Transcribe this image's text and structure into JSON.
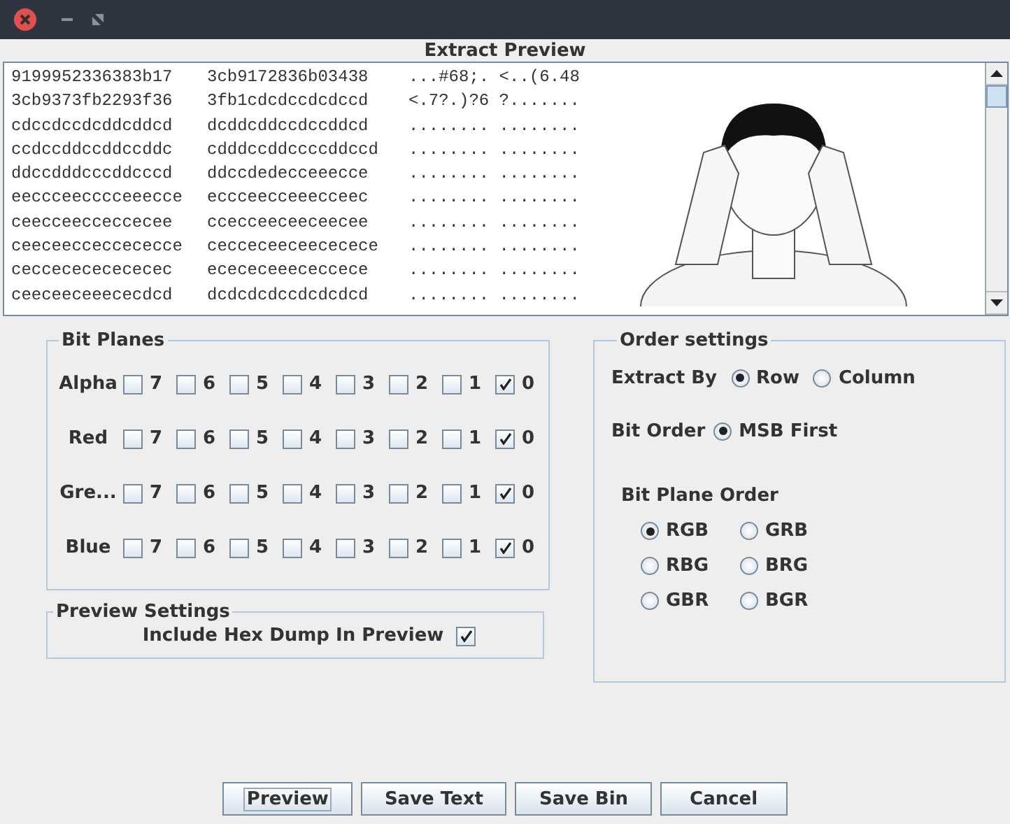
{
  "preview": {
    "title": "Extract Preview",
    "hex_rows": [
      {
        "hex1": "9199952336383b17",
        "hex2": "3cb9172836b03438",
        "ascii": "...#68;. <..(6.48"
      },
      {
        "hex1": "3cb9373fb2293f36",
        "hex2": "3fb1cdcdccdcdccd",
        "ascii": "<.7?.)?6 ?......."
      },
      {
        "hex1": "cdccdccdcddcddcd",
        "hex2": "dcddcddccdccddcd",
        "ascii": "........ ........"
      },
      {
        "hex1": "ccdccddccddccddc",
        "hex2": "cdddccddccccddccd",
        "ascii": "........ ........"
      },
      {
        "hex1": "ddccdddcccddcccd",
        "hex2": "ddccdedecceeecce",
        "ascii": "........ ........"
      },
      {
        "hex1": "eeccceecccceeecce",
        "hex2": "eccceecceeecceec",
        "ascii": "........ ........"
      },
      {
        "hex1": "ceecceecceccecee",
        "hex2": "ccecceeceeceecee",
        "ascii": "........ ........"
      },
      {
        "hex1": "ceeceecceccececce",
        "hex2": "cecceceeceececece",
        "ascii": "........ ........"
      },
      {
        "hex1": "ceccecececececec",
        "hex2": "ecececeeececcece",
        "ascii": "........ ........"
      },
      {
        "hex1": "ceeceeceeececdcd",
        "hex2": "dcdcdcdccdcdcdcd",
        "ascii": "........ ........"
      }
    ]
  },
  "bit_planes": {
    "title": "Bit Planes",
    "channels": [
      {
        "name": "Alpha",
        "bits": [
          {
            "label": "7",
            "checked": false
          },
          {
            "label": "6",
            "checked": false
          },
          {
            "label": "5",
            "checked": false
          },
          {
            "label": "4",
            "checked": false
          },
          {
            "label": "3",
            "checked": false
          },
          {
            "label": "2",
            "checked": false
          },
          {
            "label": "1",
            "checked": false
          },
          {
            "label": "0",
            "checked": true
          }
        ]
      },
      {
        "name": "Red",
        "bits": [
          {
            "label": "7",
            "checked": false
          },
          {
            "label": "6",
            "checked": false
          },
          {
            "label": "5",
            "checked": false
          },
          {
            "label": "4",
            "checked": false
          },
          {
            "label": "3",
            "checked": false
          },
          {
            "label": "2",
            "checked": false
          },
          {
            "label": "1",
            "checked": false
          },
          {
            "label": "0",
            "checked": true
          }
        ]
      },
      {
        "name": "Gre...",
        "bits": [
          {
            "label": "7",
            "checked": false
          },
          {
            "label": "6",
            "checked": false
          },
          {
            "label": "5",
            "checked": false
          },
          {
            "label": "4",
            "checked": false
          },
          {
            "label": "3",
            "checked": false
          },
          {
            "label": "2",
            "checked": false
          },
          {
            "label": "1",
            "checked": false
          },
          {
            "label": "0",
            "checked": true
          }
        ]
      },
      {
        "name": "Blue",
        "bits": [
          {
            "label": "7",
            "checked": false
          },
          {
            "label": "6",
            "checked": false
          },
          {
            "label": "5",
            "checked": false
          },
          {
            "label": "4",
            "checked": false
          },
          {
            "label": "3",
            "checked": false
          },
          {
            "label": "2",
            "checked": false
          },
          {
            "label": "1",
            "checked": false
          },
          {
            "label": "0",
            "checked": true
          }
        ]
      }
    ]
  },
  "preview_settings": {
    "title": "Preview Settings",
    "include_hex_dump": {
      "label": "Include Hex Dump In Preview",
      "checked": true
    }
  },
  "order_settings": {
    "title": "Order settings",
    "extract_by": {
      "label": "Extract By",
      "options": [
        {
          "label": "Row",
          "selected": true
        },
        {
          "label": "Column",
          "selected": false
        }
      ]
    },
    "bit_order": {
      "label": "Bit Order",
      "options": [
        {
          "label": "MSB First",
          "selected": true
        }
      ]
    },
    "bit_plane_order": {
      "label": "Bit Plane Order",
      "options": [
        {
          "label": "RGB",
          "selected": true
        },
        {
          "label": "GRB",
          "selected": false
        },
        {
          "label": "RBG",
          "selected": false
        },
        {
          "label": "BRG",
          "selected": false
        },
        {
          "label": "GBR",
          "selected": false
        },
        {
          "label": "BGR",
          "selected": false
        }
      ]
    }
  },
  "buttons": [
    {
      "label": "Preview",
      "focused": true
    },
    {
      "label": "Save Text",
      "focused": false
    },
    {
      "label": "Save Bin",
      "focused": false
    },
    {
      "label": "Cancel",
      "focused": false
    }
  ]
}
